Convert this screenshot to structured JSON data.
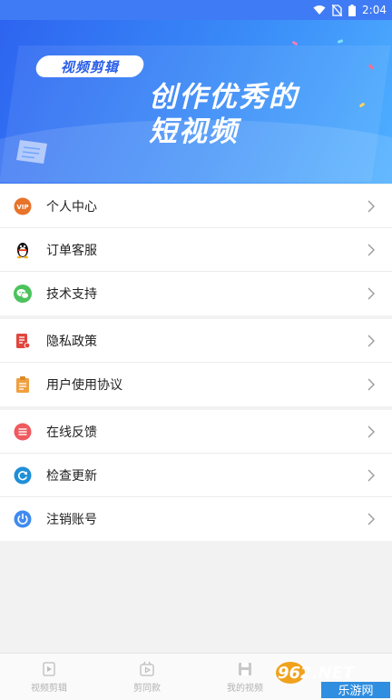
{
  "status_bar": {
    "time": "2:04"
  },
  "banner": {
    "tag": "视频剪辑",
    "headline_line1": "创作优秀的",
    "headline_line2": "短视频"
  },
  "menu": {
    "group1": [
      {
        "label": "个人中心",
        "icon": "vip-icon",
        "color": "#e8732a"
      },
      {
        "label": "订单客服",
        "icon": "qq-penguin-icon",
        "color": "#111111"
      },
      {
        "label": "技术支持",
        "icon": "wechat-icon",
        "color": "#4cc25c"
      }
    ],
    "group2": [
      {
        "label": "隐私政策",
        "icon": "privacy-document-icon",
        "color": "#e0463e"
      },
      {
        "label": "用户使用协议",
        "icon": "clipboard-icon",
        "color": "#f0a040"
      }
    ],
    "group3": [
      {
        "label": "在线反馈",
        "icon": "feedback-icon",
        "color": "#ee5a5f"
      },
      {
        "label": "检查更新",
        "icon": "refresh-icon",
        "color": "#1f8fd8"
      },
      {
        "label": "注销账号",
        "icon": "power-icon",
        "color": "#3f8bf0"
      }
    ]
  },
  "tabbar": {
    "tabs": [
      {
        "label": "视频剪辑",
        "icon": "video-edit-icon"
      },
      {
        "label": "剪同款",
        "icon": "template-icon"
      },
      {
        "label": "我的视频",
        "icon": "save-icon"
      },
      {
        "label": "",
        "icon": ""
      }
    ]
  },
  "watermark": {
    "text1": "962.NET",
    "text2": "乐游网"
  },
  "colors": {
    "accent": "#3f7bf5",
    "background": "#f2f2f2"
  }
}
